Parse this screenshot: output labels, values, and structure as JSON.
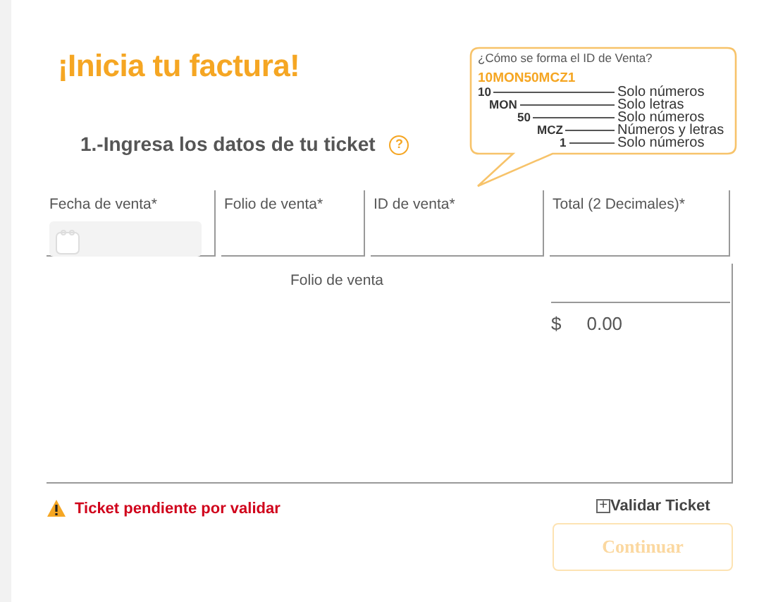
{
  "title": "¡Inicia tu factura!",
  "step": {
    "label": "1.-Ingresa los datos de tu ticket",
    "help_icon": "?"
  },
  "tooltip": {
    "question": "¿Cómo se forma el ID de Venta?",
    "example": "10MON50MCZ1",
    "parts": [
      {
        "code": "10",
        "meaning": "Solo números"
      },
      {
        "code": "MON",
        "meaning": "Solo letras"
      },
      {
        "code": "50",
        "meaning": "Solo números"
      },
      {
        "code": "MCZ",
        "meaning": "Números y letras"
      },
      {
        "code": "1",
        "meaning": "Solo números"
      }
    ]
  },
  "fields": [
    {
      "label": "Fecha de venta*",
      "kind": "date"
    },
    {
      "label": "Folio de venta*",
      "kind": "text"
    },
    {
      "label": "ID de venta*",
      "kind": "text"
    },
    {
      "label": "Total (2 Decimales)*",
      "kind": "text"
    }
  ],
  "tickets_table": {
    "column_1": "Folio de venta",
    "currency": "$",
    "total": "0.00"
  },
  "status": {
    "kind": "warning",
    "message": "Ticket pendiente por validar"
  },
  "validate_link": {
    "icon": "+",
    "label": "Validar Ticket"
  },
  "continue_button": {
    "label": "Continuar",
    "disabled": true
  }
}
